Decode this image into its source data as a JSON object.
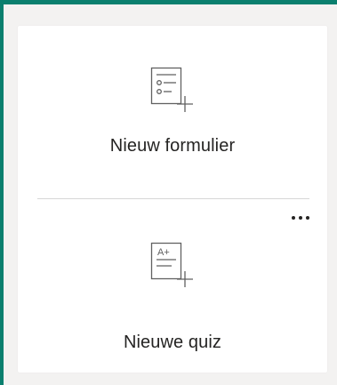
{
  "new_form": {
    "label": "Nieuw formulier",
    "icon": "form-add-icon"
  },
  "new_quiz": {
    "label": "Nieuwe quiz",
    "icon": "quiz-add-icon",
    "icon_text": "A+"
  },
  "more": {
    "icon": "more-options-icon"
  },
  "colors": {
    "frame_accent": "#0a7f6e",
    "text": "#252423",
    "icon": "#616161",
    "divider": "#d6d6d6"
  }
}
